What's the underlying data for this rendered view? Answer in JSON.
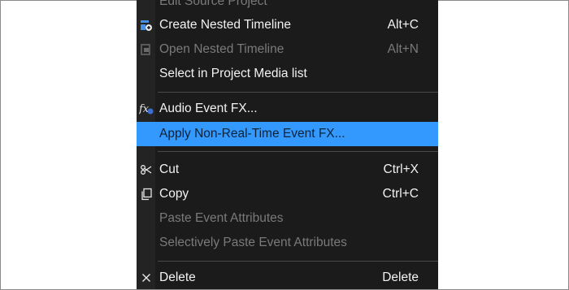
{
  "menu": {
    "items": [
      {
        "label": "Edit Source Project",
        "shortcut": "",
        "state": "disabled",
        "icon": ""
      },
      {
        "label": "Create Nested Timeline",
        "shortcut": "Alt+C",
        "state": "normal",
        "icon": "nested-timeline-icon"
      },
      {
        "label": "Open Nested Timeline",
        "shortcut": "Alt+N",
        "state": "disabled",
        "icon": "open-nested-icon"
      },
      {
        "label": "Select in Project Media list",
        "shortcut": "",
        "state": "normal",
        "icon": ""
      },
      {
        "label": "Audio Event FX...",
        "shortcut": "",
        "state": "normal",
        "icon": "fx-icon"
      },
      {
        "label": "Apply Non-Real-Time Event FX...",
        "shortcut": "",
        "state": "highlight",
        "icon": ""
      },
      {
        "label": "Cut",
        "shortcut": "Ctrl+X",
        "state": "normal",
        "icon": "scissors-icon"
      },
      {
        "label": "Copy",
        "shortcut": "Ctrl+C",
        "state": "normal",
        "icon": "copy-icon"
      },
      {
        "label": "Paste Event Attributes",
        "shortcut": "",
        "state": "disabled",
        "icon": ""
      },
      {
        "label": "Selectively Paste Event Attributes",
        "shortcut": "",
        "state": "disabled",
        "icon": ""
      },
      {
        "label": "Delete",
        "shortcut": "Delete",
        "state": "normal",
        "icon": "delete-icon"
      }
    ]
  },
  "colors": {
    "menu_bg": "#1b1b1b",
    "highlight": "#3399ff",
    "text": "#f2f2f2",
    "disabled_text": "#7a7a7a"
  }
}
